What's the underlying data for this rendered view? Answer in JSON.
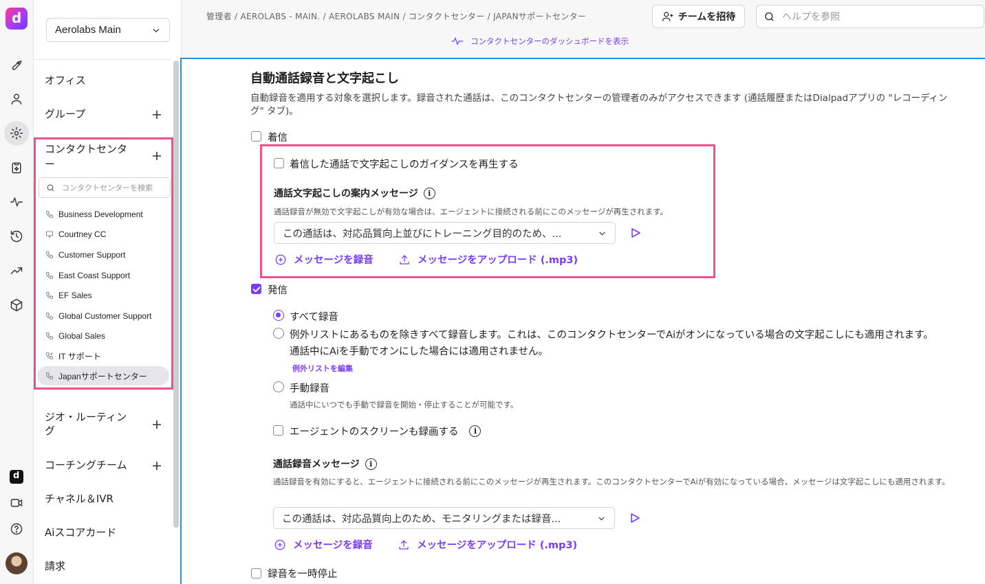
{
  "rail": {
    "logo_letter": "d",
    "mini_logo_letter": "d"
  },
  "sidebar": {
    "workspace": "Aerolabs Main",
    "items": [
      {
        "label": "オフィス"
      },
      {
        "label": "グループ"
      },
      {
        "label": "コンタクトセンター"
      },
      {
        "label": "ジオ・ルーティング"
      },
      {
        "label": "コーチングチーム"
      },
      {
        "label": "チャネル＆IVR"
      },
      {
        "label": "Aiスコアカード"
      },
      {
        "label": "請求"
      }
    ],
    "cc_search_placeholder": "コンタクトセンターを検索",
    "cc_items": [
      {
        "label": "Business Development",
        "icon": "phone-icon"
      },
      {
        "label": "Courtney CC",
        "icon": "monitor-icon"
      },
      {
        "label": "Customer Support",
        "icon": "phone-icon"
      },
      {
        "label": "East Coast Support",
        "icon": "phone-icon"
      },
      {
        "label": "EF Sales",
        "icon": "phone-icon"
      },
      {
        "label": "Global Customer Support",
        "icon": "phone-icon"
      },
      {
        "label": "Global Sales",
        "icon": "phone-icon"
      },
      {
        "label": "IT サポート",
        "icon": "phone-gear-icon"
      },
      {
        "label": "Japanサポートセンター",
        "icon": "phone-icon"
      }
    ]
  },
  "header": {
    "breadcrumb": "管理者 / AEROLABS - MAIN. / AEROLABS MAIN / コンタクトセンター / JAPANサポートセンター",
    "dashboard_link": "コンタクトセンターのダッシュボードを表示",
    "invite_label": "チームを招待",
    "help_placeholder": "ヘルプを参照"
  },
  "main": {
    "title": "自動通話録音と文字起こし",
    "description": "自動録音を適用する対象を選択します。録音された通話は、このコンタクトセンターの管理者のみがアクセスできます (通話履歴またはDialpadアプリの \"レコーディング\" タブ)。",
    "incoming": {
      "label": "着信",
      "checked": false,
      "guidance_label": "着信した通話で文字起こしのガイダンスを再生する",
      "message_title": "通話文字起こしの案内メッセージ",
      "message_desc": "通話録音が無効で文字起こしが有効な場合は、エージェントに接続される前にこのメッセージが再生されます。",
      "message_value": "この通話は、対応品質向上並びにトレーニング目的のため、...",
      "record_label": "メッセージを録音",
      "upload_label": "メッセージをアップロード (.mp3)"
    },
    "outgoing": {
      "label": "発信",
      "checked": true,
      "opt_all": "すべて録音",
      "opt_except_line1": "例外リストにあるものを除きすべて録音します。これは、このコンタクトセンターでAiがオンになっている場合の文字起こしにも適用されます。",
      "opt_except_line2": "通話中にAiを手動でオンにした場合には適用されません。",
      "edit_exceptions": "例外リストを編集",
      "opt_manual": "手動録音",
      "opt_manual_desc": "通話中にいつでも手動で録音を開始・停止することが可能です。",
      "screen_label": "エージェントのスクリーンも録画する",
      "rec_msg_title": "通話録音メッセージ",
      "rec_msg_desc": "通話録音を有効にすると、エージェントに接続される前にこのメッセージが再生されます。このコンタクトセンターでAiが有効になっている場合、メッセージは文字起こしにも適用されます。",
      "rec_msg_value": "この通話は、対応品質向上のため、モニタリングまたは録音...",
      "record_label": "メッセージを録音",
      "upload_label": "メッセージをアップロード (.mp3)"
    },
    "pause_label": "録音を一時停止"
  },
  "colors": {
    "accent": "#7a3cff",
    "highlight": "#f04e8c",
    "focus": "#2e8fd9"
  }
}
